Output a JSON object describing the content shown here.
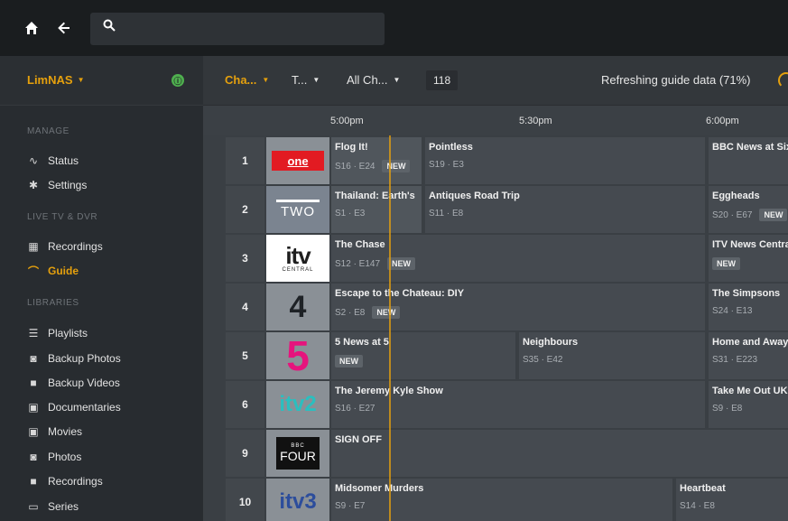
{
  "topbar": {
    "search_placeholder": ""
  },
  "sidebar": {
    "server_name": "LimNAS",
    "server_status": "ⓘ",
    "sections": {
      "manage": "MANAGE",
      "livetv": "LIVE TV & DVR",
      "libraries": "LIBRARIES"
    },
    "items": [
      {
        "label": "Status",
        "icon": "pulse-icon"
      },
      {
        "label": "Settings",
        "icon": "gear-icon"
      },
      {
        "label": "Recordings",
        "icon": "calendar-icon"
      },
      {
        "label": "Guide",
        "icon": "guide-icon"
      },
      {
        "label": "Playlists",
        "icon": "list-icon"
      },
      {
        "label": "Backup Photos",
        "icon": "camera-icon"
      },
      {
        "label": "Backup Videos",
        "icon": "video-icon"
      },
      {
        "label": "Documentaries",
        "icon": "film-icon"
      },
      {
        "label": "Movies",
        "icon": "film-icon"
      },
      {
        "label": "Photos",
        "icon": "camera-icon"
      },
      {
        "label": "Recordings",
        "icon": "video-icon"
      },
      {
        "label": "Series",
        "icon": "tv-icon"
      }
    ]
  },
  "toolbar": {
    "filter_channel": "Cha...",
    "filter_type": "T...",
    "filter_all": "All Ch...",
    "count": "118",
    "refresh_status": "Refreshing guide data (71%)"
  },
  "times": [
    "5:00pm",
    "5:30pm",
    "6:00pm"
  ],
  "channels": [
    {
      "number": "1",
      "logo": "BBC One",
      "programs": [
        {
          "title": "Flog It!",
          "meta": "S16 · E24",
          "new": "NEW"
        },
        {
          "title": "Pointless",
          "meta": "S19 · E3",
          "new": ""
        },
        {
          "title": "BBC News at Six",
          "meta": "",
          "new": ""
        }
      ]
    },
    {
      "number": "2",
      "logo": "BBC Two",
      "programs": [
        {
          "title": "Thailand: Earth's",
          "meta": "S1 · E3",
          "new": ""
        },
        {
          "title": "Antiques Road Trip",
          "meta": "S11 · E8",
          "new": ""
        },
        {
          "title": "Eggheads",
          "meta": "S20 · E67",
          "new": "NEW"
        }
      ]
    },
    {
      "number": "3",
      "logo": "ITV Central",
      "programs": [
        {
          "title": "The Chase",
          "meta": "S12 · E147",
          "new": "NEW"
        },
        {
          "title": "ITV News Central",
          "meta": "",
          "new": "NEW"
        }
      ]
    },
    {
      "number": "4",
      "logo": "Channel 4",
      "programs": [
        {
          "title": "Escape to the Chateau: DIY",
          "meta": "S2 · E8",
          "new": "NEW"
        },
        {
          "title": "The Simpsons",
          "meta": "S24 · E13",
          "new": ""
        }
      ]
    },
    {
      "number": "5",
      "logo": "Channel 5",
      "programs": [
        {
          "title": "5 News at 5",
          "meta": "",
          "new": "NEW"
        },
        {
          "title": "Neighbours",
          "meta": "S35 · E42",
          "new": ""
        },
        {
          "title": "Home and Away",
          "meta": "S31 · E223",
          "new": ""
        }
      ]
    },
    {
      "number": "6",
      "logo": "ITV2",
      "programs": [
        {
          "title": "The Jeremy Kyle Show",
          "meta": "S16 · E27",
          "new": ""
        },
        {
          "title": "Take Me Out UK",
          "meta": "S9 · E8",
          "new": ""
        }
      ]
    },
    {
      "number": "9",
      "logo": "BBC Four",
      "programs": [
        {
          "title": "SIGN OFF",
          "meta": "",
          "new": ""
        }
      ]
    },
    {
      "number": "10",
      "logo": "ITV3",
      "programs": [
        {
          "title": "Midsomer Murders",
          "meta": "S9 · E7",
          "new": ""
        },
        {
          "title": "Heartbeat",
          "meta": "S14 · E8",
          "new": ""
        }
      ]
    }
  ],
  "logos": {
    "bbc_one": "one",
    "bbc_two": "TWO",
    "itv": "itv",
    "itv_region": "CENTRAL",
    "ch4": "4",
    "ch5": "5",
    "itv2": "itv2",
    "bbc": "BBC",
    "four": "FOUR",
    "itv3": "itv3"
  }
}
